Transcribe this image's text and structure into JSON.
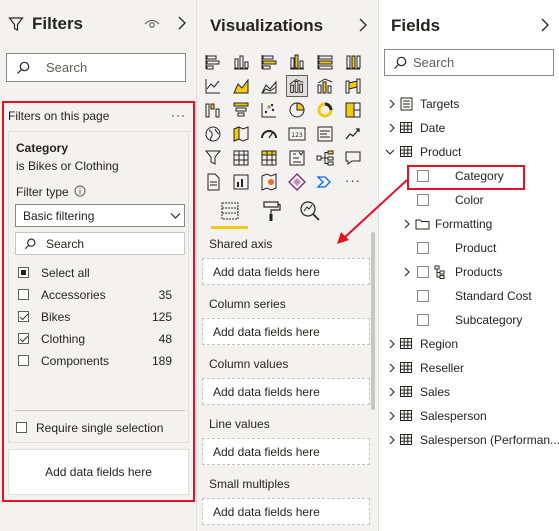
{
  "filters": {
    "title": "Filters",
    "search_placeholder": "Search",
    "section_label": "Filters on this page",
    "more_label": "···",
    "card": {
      "title": "Category",
      "subtitle": "is Bikes or Clothing",
      "filter_type_label": "Filter type",
      "filter_type_value": "Basic filtering",
      "search_placeholder": "Search",
      "items": [
        {
          "label": "Select all",
          "count": "",
          "state": "partial"
        },
        {
          "label": "Accessories",
          "count": "35",
          "state": "unchecked"
        },
        {
          "label": "Bikes",
          "count": "125",
          "state": "checked"
        },
        {
          "label": "Clothing",
          "count": "48",
          "state": "checked"
        },
        {
          "label": "Components",
          "count": "189",
          "state": "unchecked"
        }
      ],
      "require_single": "Require single selection"
    },
    "add_fields": "Add data fields here"
  },
  "viz": {
    "title": "Visualizations",
    "wells": [
      {
        "label": "Shared axis",
        "placeholder": "Add data fields here"
      },
      {
        "label": "Column series",
        "placeholder": "Add data fields here"
      },
      {
        "label": "Column values",
        "placeholder": "Add data fields here"
      },
      {
        "label": "Line values",
        "placeholder": "Add data fields here"
      },
      {
        "label": "Small multiples",
        "placeholder": "Add data fields here"
      }
    ],
    "more": "···"
  },
  "fields": {
    "title": "Fields",
    "search_placeholder": "Search",
    "items": [
      {
        "label": "Targets",
        "kind": "calc-table",
        "level": 0,
        "expand": "collapsed"
      },
      {
        "label": "Date",
        "kind": "table",
        "level": 0,
        "expand": "collapsed"
      },
      {
        "label": "Product",
        "kind": "table",
        "level": 0,
        "expand": "expanded"
      },
      {
        "label": "Category",
        "kind": "field",
        "level": 1,
        "expand": "none"
      },
      {
        "label": "Color",
        "kind": "field",
        "level": 1,
        "expand": "none"
      },
      {
        "label": "Formatting",
        "kind": "folder",
        "level": 1,
        "expand": "collapsed"
      },
      {
        "label": "Product",
        "kind": "field",
        "level": 1,
        "expand": "none"
      },
      {
        "label": "Products",
        "kind": "hierarchy",
        "level": 1,
        "expand": "collapsed"
      },
      {
        "label": "Standard Cost",
        "kind": "field",
        "level": 1,
        "expand": "none"
      },
      {
        "label": "Subcategory",
        "kind": "field",
        "level": 1,
        "expand": "none"
      },
      {
        "label": "Region",
        "kind": "table",
        "level": 0,
        "expand": "collapsed"
      },
      {
        "label": "Reseller",
        "kind": "table",
        "level": 0,
        "expand": "collapsed"
      },
      {
        "label": "Sales",
        "kind": "table",
        "level": 0,
        "expand": "collapsed"
      },
      {
        "label": "Salesperson",
        "kind": "table",
        "level": 0,
        "expand": "collapsed"
      },
      {
        "label": "Salesperson (Performan...",
        "kind": "table",
        "level": 0,
        "expand": "collapsed"
      }
    ]
  },
  "colors": {
    "accent_red": "#e81123",
    "viz_yellow": "#f2c811",
    "pane_bg": "#f3f2f1"
  }
}
